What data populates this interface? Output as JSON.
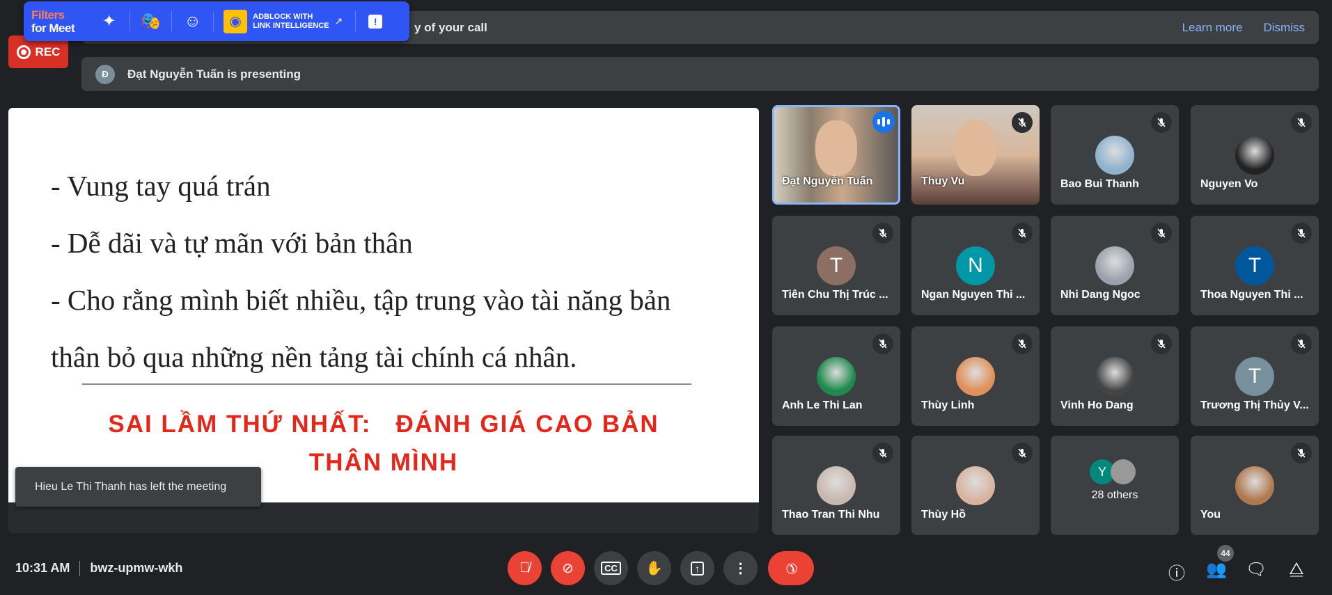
{
  "banner": {
    "text": "y of your call",
    "learn_more": "Learn more",
    "dismiss": "Dismiss"
  },
  "presenting": {
    "initial": "Đ",
    "text": "Đạt Nguyễn Tuấn is presenting"
  },
  "rec": "REC",
  "extension": {
    "brand_line1": "Filters",
    "brand_line2": "for Meet",
    "adblock_line1": "ADBLOCK WITH",
    "adblock_line2": "LINK INTELLIGENCE"
  },
  "slide": {
    "lines": [
      "- Vung tay quá trán",
      "- Dễ dãi và tự mãn với bản thân",
      "- Cho rằng mình biết nhiều, tập trung vào tài năng bản",
      "thân bỏ qua những nền tảng tài chính cá nhân."
    ],
    "title_line1": "SAI LẦM THỨ NHẤT:   ĐÁNH GIÁ CAO BẢN",
    "title_line2": "THÂN MÌNH"
  },
  "toast": "Hieu Le Thi Thanh has left the meeting",
  "tiles": [
    {
      "name": "Đạt Nguyễn Tuấn",
      "type": "video",
      "speaking": true
    },
    {
      "name": "Thuy Vu",
      "type": "video"
    },
    {
      "name": "Bao Bui Thanh",
      "type": "photo",
      "color": "#8fb3cf"
    },
    {
      "name": "Nguyen Vo",
      "type": "photo",
      "color": "#222222"
    },
    {
      "name": "Tiên Chu Thị Trúc ...",
      "type": "initial",
      "initial": "T",
      "color": "#8d6e63"
    },
    {
      "name": "Ngan Nguyen Thi ...",
      "type": "initial",
      "initial": "N",
      "color": "#0097a7"
    },
    {
      "name": "Nhi Dang Ngoc",
      "type": "photo",
      "color": "#9aa3ad"
    },
    {
      "name": "Thoa Nguyen Thi ...",
      "type": "initial",
      "initial": "T",
      "color": "#01579b"
    },
    {
      "name": "Anh Le Thi Lan",
      "type": "photo",
      "color": "#1f8a4c"
    },
    {
      "name": "Thùy Linh",
      "type": "photo",
      "color": "#e0905a"
    },
    {
      "name": "Vinh Ho Dang",
      "type": "photo",
      "color": "#444444"
    },
    {
      "name": "Trương Thị Thủy V...",
      "type": "initial",
      "initial": "T",
      "color": "#78909c"
    },
    {
      "name": "Thao Tran Thi Nhu",
      "type": "photo",
      "color": "#c9b8b0"
    },
    {
      "name": "Thùy Hồ",
      "type": "photo",
      "color": "#d8b4a0"
    },
    {
      "name": "28 others",
      "type": "others",
      "initial": "Y",
      "color": "#00897b"
    },
    {
      "name": "You",
      "type": "photo",
      "color": "#b07a50"
    }
  ],
  "bottom": {
    "time": "10:31 AM",
    "meeting_code": "bwz-upmw-wkh",
    "people_count": "44"
  },
  "colors": {
    "accent": "#8ab4f8",
    "danger": "#ea4335",
    "extension": "#3055f5"
  }
}
